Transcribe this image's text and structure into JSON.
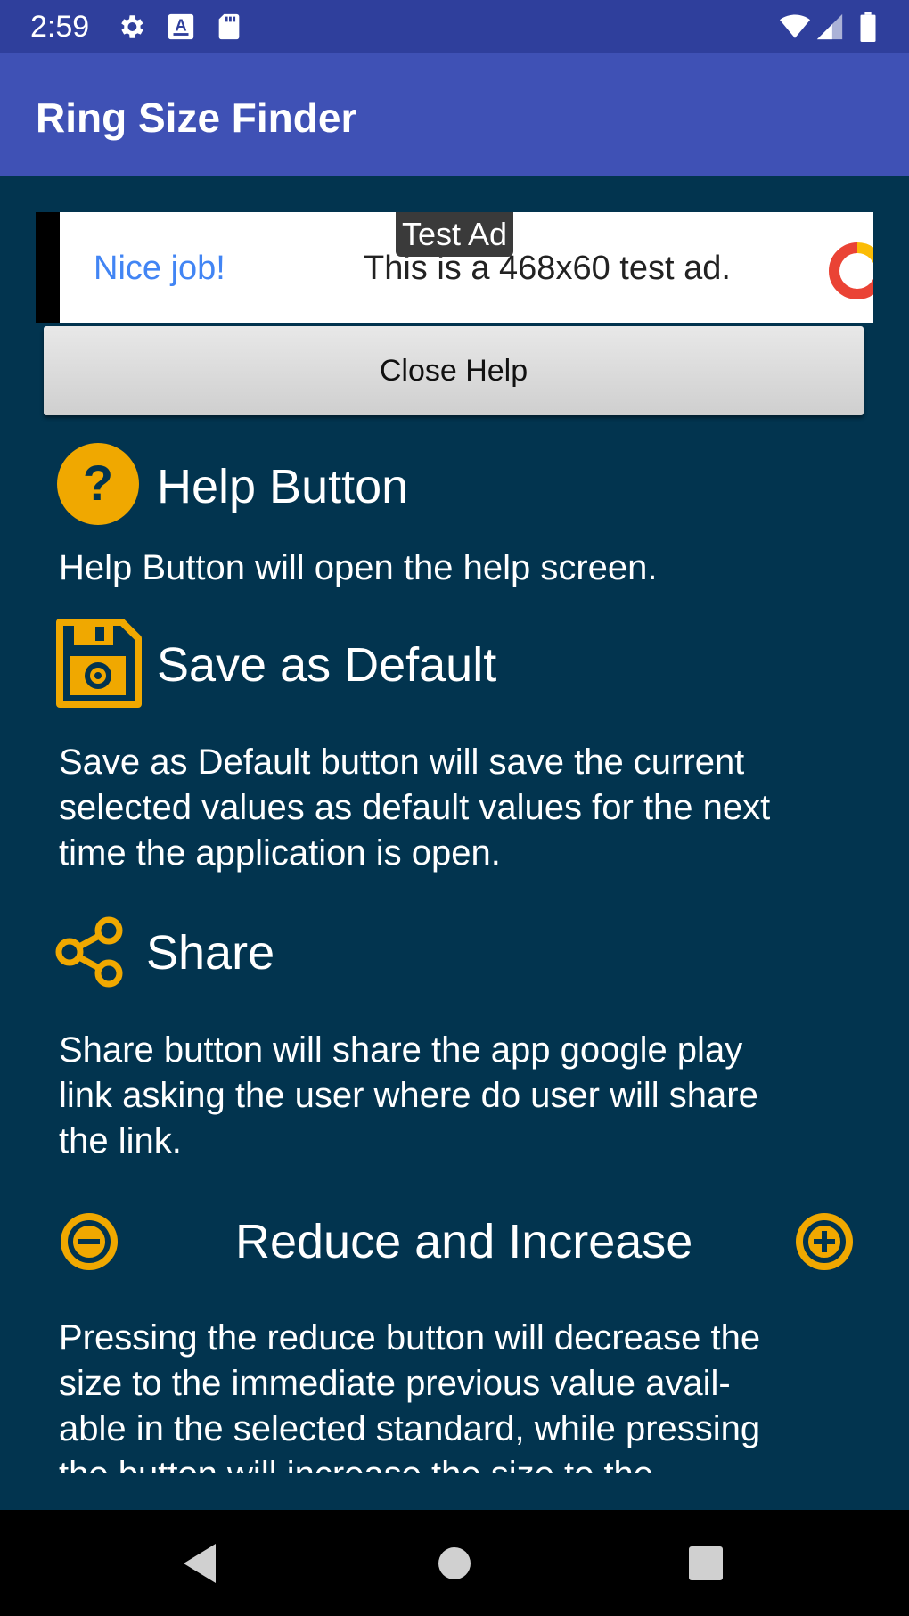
{
  "status_bar": {
    "time": "2:59",
    "icons_left": [
      "gear-icon",
      "a-keyboard-icon",
      "sd-card-icon"
    ],
    "icons_right": [
      "wifi-icon",
      "signal-icon",
      "battery-icon"
    ]
  },
  "app_bar": {
    "title": "Ring Size Finder"
  },
  "ad": {
    "badge": "Test Ad",
    "headline": "Nice job!",
    "text": "This is a 468x60 test ad."
  },
  "close_help": {
    "label": "Close Help"
  },
  "sections": {
    "help": {
      "icon": "help-circle-icon",
      "title": "Help Button",
      "body": "Help Button will open the help screen."
    },
    "save": {
      "icon": "save-settings-icon",
      "title": "Save as Default",
      "body_lines": [
        "Save as Default button will save the current",
        "selected values as default values for the next",
        "time the application is open."
      ]
    },
    "share": {
      "icon": "share-icon",
      "title": "Share",
      "body_lines": [
        "Share button will share the app google play",
        "link asking the user where do user will share",
        "the link."
      ]
    },
    "reduce_increase": {
      "icons": [
        "minus-circle-icon",
        "plus-circle-icon"
      ],
      "title": "Reduce and Increase",
      "body_lines": [
        "Pressing the reduce button will decrease the",
        "size to the immediate previous value avail-",
        "able in the selected standard, while pressing",
        "the button will increase the size to the"
      ]
    }
  },
  "nav": {
    "buttons": [
      "back-icon",
      "home-icon",
      "recents-icon"
    ]
  },
  "colors": {
    "accent": "#f0a800",
    "background": "#02344f",
    "app_bar": "#3f51b5",
    "status_bar": "#2f3f9c"
  }
}
